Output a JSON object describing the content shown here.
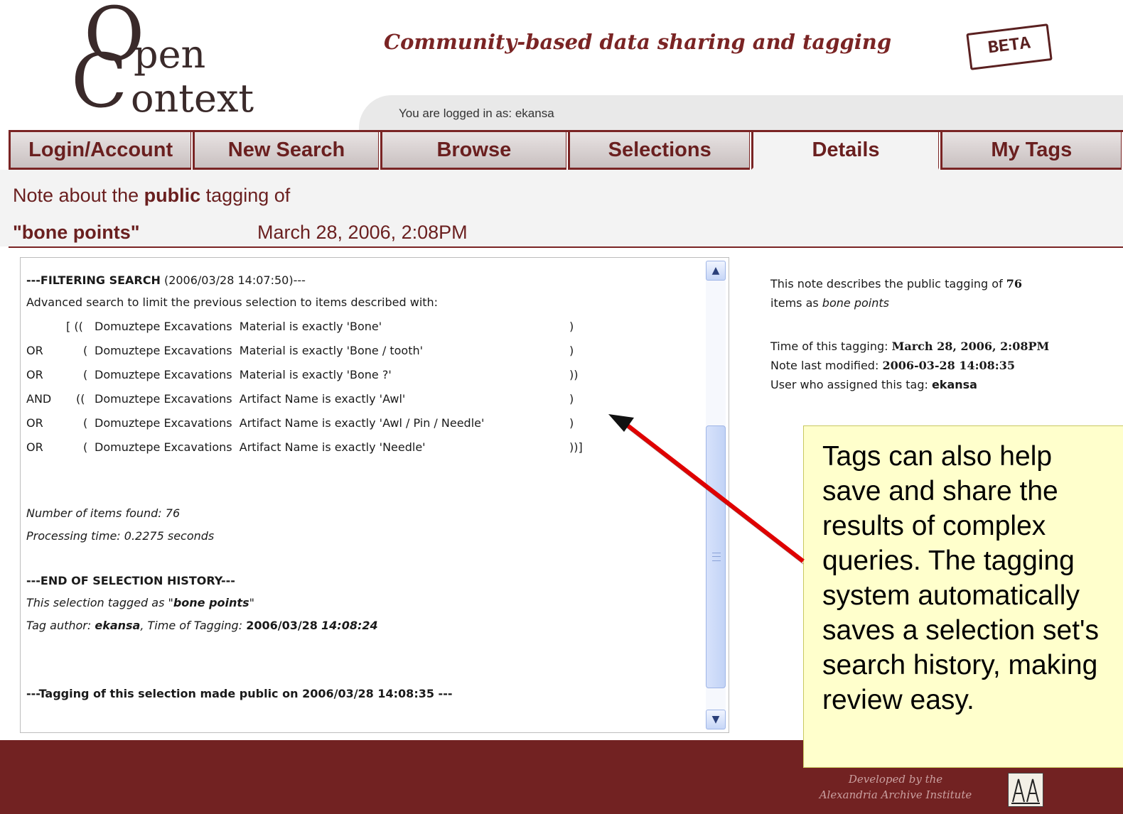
{
  "header": {
    "logo": {
      "o": "O",
      "pen": "pen",
      "c": "C",
      "ontext": "ontext"
    },
    "tagline": "Community-based data sharing and tagging",
    "beta_badge": "BETA",
    "login_status": "You are logged in as: ekansa"
  },
  "tabs": [
    {
      "label": "Login/Account",
      "active": false
    },
    {
      "label": "New Search",
      "active": false
    },
    {
      "label": "Browse",
      "active": false
    },
    {
      "label": "Selections",
      "active": false
    },
    {
      "label": "Details",
      "active": true
    },
    {
      "label": "My Tags",
      "active": false
    }
  ],
  "note_header": {
    "prefix": "Note about the ",
    "emphasis": "public",
    "suffix": " tagging of",
    "tag_name": "\"bone points\"",
    "tag_date": "March 28, 2006, 2:08PM"
  },
  "history": {
    "filter_heading": "---FILTERING SEARCH",
    "filter_time": " (2006/03/28 14:07:50)---",
    "filter_desc": "Advanced search to limit the previous selection to items described with:",
    "query_rows": [
      {
        "op": "",
        "open": "[ ((",
        "clause": "Domuztepe Excavations  Material is exactly 'Bone'",
        "close": ")"
      },
      {
        "op": "OR",
        "open": "(",
        "clause": "Domuztepe Excavations  Material is exactly 'Bone / tooth'",
        "close": ")"
      },
      {
        "op": "OR",
        "open": "(",
        "clause": "Domuztepe Excavations  Material is exactly 'Bone ?'",
        "close": "))"
      },
      {
        "op": "AND",
        "open": "((",
        "clause": "Domuztepe Excavations  Artifact Name is exactly 'Awl'",
        "close": ")"
      },
      {
        "op": "OR",
        "open": "(",
        "clause": "Domuztepe Excavations  Artifact Name is exactly 'Awl / Pin / Needle'",
        "close": ")"
      },
      {
        "op": "OR",
        "open": "(",
        "clause": "Domuztepe Excavations  Artifact Name is exactly 'Needle'",
        "close": "))]"
      }
    ],
    "items_found": "Number of items found: 76",
    "processing_time": "Processing time: 0.2275 seconds",
    "end_heading": "---END OF SELECTION HISTORY---",
    "tagged_prefix": "This selection tagged as \"",
    "tagged_name": "bone points",
    "tagged_suffix": "\"",
    "author_prefix": "Tag author: ",
    "author": "ekansa",
    "time_prefix": ", Time of Tagging: ",
    "tag_date": "2006/03/28",
    "tag_time": "14:08:24",
    "public_line": "---Tagging of this selection made public on 2006/03/28 14:08:35 ---"
  },
  "info": {
    "desc_prefix": "This note describes the public tagging of ",
    "count": "76",
    "desc_mid": "items as ",
    "tag": "bone points",
    "time_label": "Time of this tagging: ",
    "time_value": "March 28, 2006, 2:08PM",
    "modified_label": "Note last modified: ",
    "modified_value": "2006-03-28 14:08:35",
    "user_label": "User who assigned this tag: ",
    "user_value": "ekansa"
  },
  "callout": {
    "lines": [
      "Tags can also help",
      "save and share the",
      "results of complex",
      "queries. The tagging",
      "system automatically",
      "saves a selection set's",
      "search history, making",
      "review easy."
    ]
  },
  "footer": {
    "developed_by": "Developed by the",
    "institute": "Alexandria Archive Institute"
  },
  "colors": {
    "brand": "#722222",
    "callout_bg": "#ffffcc",
    "arrow": "#e00000"
  }
}
